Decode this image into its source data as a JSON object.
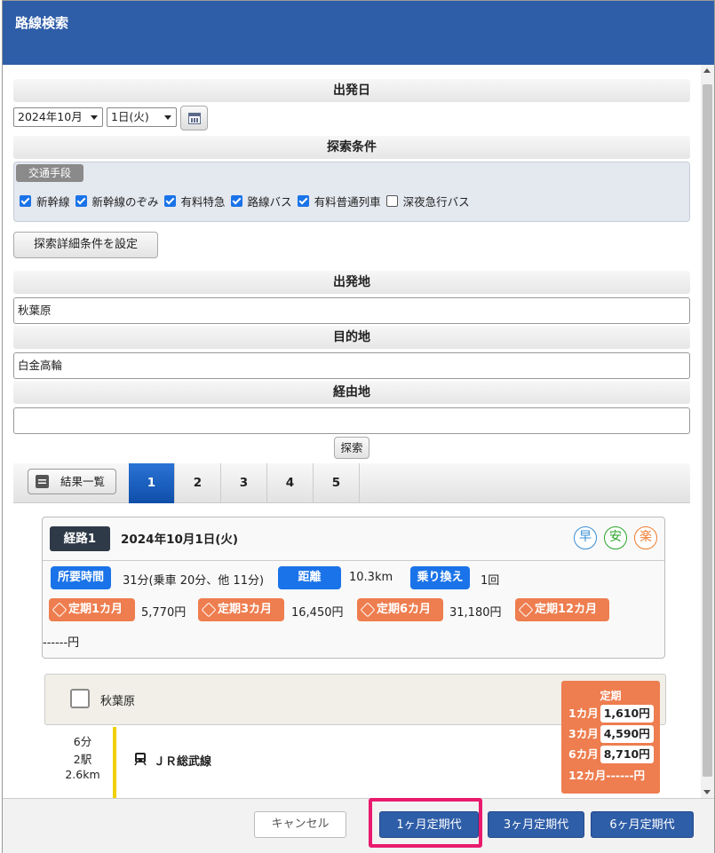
{
  "background": {
    "title_fragment": ""
  },
  "dialog": {
    "title": "路線検索"
  },
  "date_section": {
    "heading": "出発日",
    "month_value": "2024年10月",
    "day_value": "1日(火)"
  },
  "condition_section": {
    "heading": "探索条件",
    "transport_tag": "交通手段",
    "checkboxes": [
      {
        "label": "新幹線",
        "checked": true
      },
      {
        "label": "新幹線のぞみ",
        "checked": true
      },
      {
        "label": "有料特急",
        "checked": true
      },
      {
        "label": "路線バス",
        "checked": true
      },
      {
        "label": "有料普通列車",
        "checked": true
      },
      {
        "label": "深夜急行バス",
        "checked": false
      }
    ],
    "detail_button": "探索詳細条件を設定"
  },
  "from_section": {
    "heading": "出発地",
    "value": "秋葉原"
  },
  "to_section": {
    "heading": "目的地",
    "value": "白金高輪"
  },
  "via_section": {
    "heading": "経由地",
    "value": ""
  },
  "search_button": "探索",
  "tabs": {
    "list_button": "結果一覧",
    "items": [
      "1",
      "2",
      "3",
      "4",
      "5"
    ],
    "active_index": 0
  },
  "route": {
    "badge": "経路1",
    "date": "2024年10月1日(火)",
    "icons": [
      {
        "char": "早",
        "color": "#3a8fd6"
      },
      {
        "char": "安",
        "color": "#2aa52a"
      },
      {
        "char": "楽",
        "color": "#ee7d2f"
      }
    ],
    "time_label": "所要時間",
    "time_value": "31分(乗車 20分、他 11分)",
    "distance_label": "距離",
    "distance_value": "10.3km",
    "transfer_label": "乗り換え",
    "transfer_value": "1回",
    "fares": [
      {
        "label": "定期1カ月",
        "value": "5,770円"
      },
      {
        "label": "定期3カ月",
        "value": "16,450円"
      },
      {
        "label": "定期6カ月",
        "value": "31,180円"
      },
      {
        "label": "定期12カ月",
        "value": "------円"
      }
    ]
  },
  "station": {
    "name": "秋葉原"
  },
  "teiki_box": {
    "title": "定期",
    "rows": [
      {
        "label": "1カ月",
        "value": "1,610円"
      },
      {
        "label": "3カ月",
        "value": "4,590円"
      },
      {
        "label": "6カ月",
        "value": "8,710円"
      },
      {
        "label": "12カ月",
        "value": "------円"
      }
    ]
  },
  "segment": {
    "minutes": "6分",
    "stations": "2駅",
    "distance": "2.6km",
    "line_name": "ＪＲ総武線",
    "line_color": "#f0d000"
  },
  "footer": {
    "cancel": "キャンセル",
    "month1": "1ヶ月定期代",
    "month3": "3ヶ月定期代",
    "month6": "6ヶ月定期代"
  }
}
